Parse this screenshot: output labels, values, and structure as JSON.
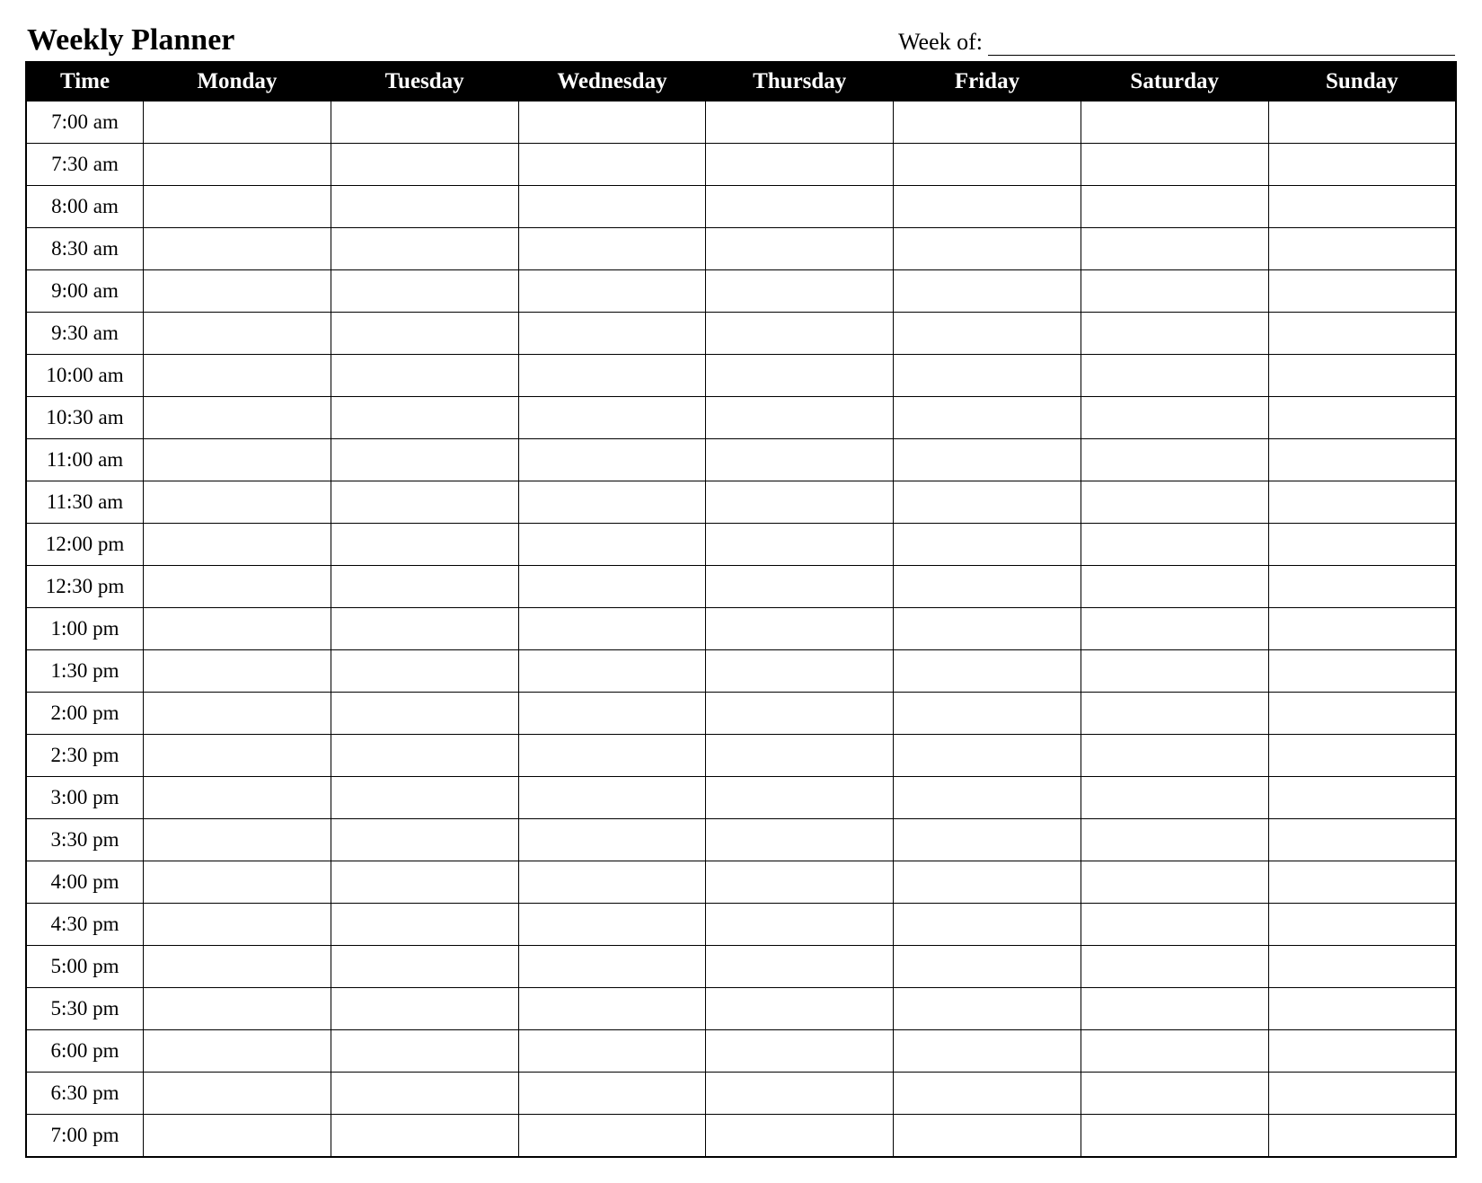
{
  "title": "Weekly Planner",
  "week_of_label": "Week of:",
  "week_of_value": "",
  "columns": [
    "Time",
    "Monday",
    "Tuesday",
    "Wednesday",
    "Thursday",
    "Friday",
    "Saturday",
    "Sunday"
  ],
  "rows": [
    {
      "time": "7:00 am",
      "cells": [
        "",
        "",
        "",
        "",
        "",
        "",
        ""
      ]
    },
    {
      "time": "7:30 am",
      "cells": [
        "",
        "",
        "",
        "",
        "",
        "",
        ""
      ]
    },
    {
      "time": "8:00 am",
      "cells": [
        "",
        "",
        "",
        "",
        "",
        "",
        ""
      ]
    },
    {
      "time": "8:30 am",
      "cells": [
        "",
        "",
        "",
        "",
        "",
        "",
        ""
      ]
    },
    {
      "time": "9:00 am",
      "cells": [
        "",
        "",
        "",
        "",
        "",
        "",
        ""
      ]
    },
    {
      "time": "9:30 am",
      "cells": [
        "",
        "",
        "",
        "",
        "",
        "",
        ""
      ]
    },
    {
      "time": "10:00 am",
      "cells": [
        "",
        "",
        "",
        "",
        "",
        "",
        ""
      ]
    },
    {
      "time": "10:30 am",
      "cells": [
        "",
        "",
        "",
        "",
        "",
        "",
        ""
      ]
    },
    {
      "time": "11:00 am",
      "cells": [
        "",
        "",
        "",
        "",
        "",
        "",
        ""
      ]
    },
    {
      "time": "11:30 am",
      "cells": [
        "",
        "",
        "",
        "",
        "",
        "",
        ""
      ]
    },
    {
      "time": "12:00 pm",
      "cells": [
        "",
        "",
        "",
        "",
        "",
        "",
        ""
      ]
    },
    {
      "time": "12:30 pm",
      "cells": [
        "",
        "",
        "",
        "",
        "",
        "",
        ""
      ]
    },
    {
      "time": "1:00 pm",
      "cells": [
        "",
        "",
        "",
        "",
        "",
        "",
        ""
      ]
    },
    {
      "time": "1:30 pm",
      "cells": [
        "",
        "",
        "",
        "",
        "",
        "",
        ""
      ]
    },
    {
      "time": "2:00 pm",
      "cells": [
        "",
        "",
        "",
        "",
        "",
        "",
        ""
      ]
    },
    {
      "time": "2:30 pm",
      "cells": [
        "",
        "",
        "",
        "",
        "",
        "",
        ""
      ]
    },
    {
      "time": "3:00 pm",
      "cells": [
        "",
        "",
        "",
        "",
        "",
        "",
        ""
      ]
    },
    {
      "time": "3:30 pm",
      "cells": [
        "",
        "",
        "",
        "",
        "",
        "",
        ""
      ]
    },
    {
      "time": "4:00 pm",
      "cells": [
        "",
        "",
        "",
        "",
        "",
        "",
        ""
      ]
    },
    {
      "time": "4:30 pm",
      "cells": [
        "",
        "",
        "",
        "",
        "",
        "",
        ""
      ]
    },
    {
      "time": "5:00 pm",
      "cells": [
        "",
        "",
        "",
        "",
        "",
        "",
        ""
      ]
    },
    {
      "time": "5:30 pm",
      "cells": [
        "",
        "",
        "",
        "",
        "",
        "",
        ""
      ]
    },
    {
      "time": "6:00 pm",
      "cells": [
        "",
        "",
        "",
        "",
        "",
        "",
        ""
      ]
    },
    {
      "time": "6:30 pm",
      "cells": [
        "",
        "",
        "",
        "",
        "",
        "",
        ""
      ]
    },
    {
      "time": "7:00 pm",
      "cells": [
        "",
        "",
        "",
        "",
        "",
        "",
        ""
      ]
    }
  ]
}
